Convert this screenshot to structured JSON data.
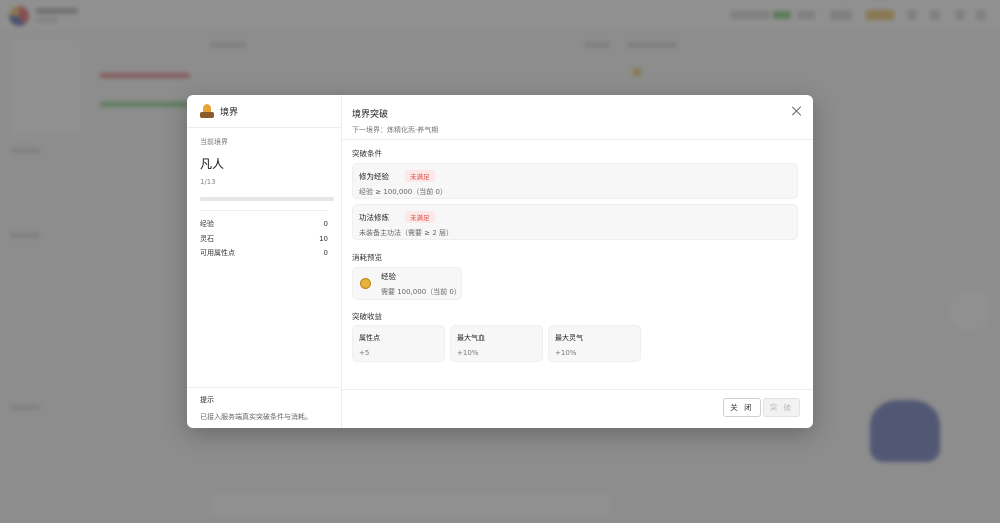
{
  "modal": {
    "left_title": "境界",
    "current_realm_label": "当前境界",
    "current_realm": "凡人",
    "progress_text": "1/13",
    "progress_value": 0.0,
    "stats": [
      {
        "label": "经验",
        "value": "0"
      },
      {
        "label": "灵石",
        "value": "10"
      },
      {
        "label": "可用属性点",
        "value": "0"
      }
    ],
    "hint_title": "提示",
    "hint_text": "已接入服务端真实突破条件与消耗。",
    "right_title": "境界突破",
    "next_realm": "下一境界：炼精化炁·养气期",
    "conditions_title": "突破条件",
    "conditions": [
      {
        "name": "修为经验",
        "status": "未满足",
        "desc": "经验 ≥ 100,000（当前 0）"
      },
      {
        "name": "功法修炼",
        "status": "未满足",
        "desc": "未装备主功法（需要 ≥ 2 层）"
      }
    ],
    "cost_title": "消耗预览",
    "cost": {
      "name": "经验",
      "desc": "需要 100,000（当前 0）"
    },
    "benefits_title": "突破收益",
    "benefits": [
      {
        "name": "属性点",
        "value": "+5"
      },
      {
        "name": "最大气血",
        "value": "+10%"
      },
      {
        "name": "最大灵气",
        "value": "+10%"
      }
    ],
    "close_label": "关 闭",
    "break_label": "突 破"
  },
  "colors": {
    "badge_text": "#e14b4b",
    "badge_bg": "#fde8e8",
    "overlay": "rgba(0,0,0,0.42)"
  }
}
